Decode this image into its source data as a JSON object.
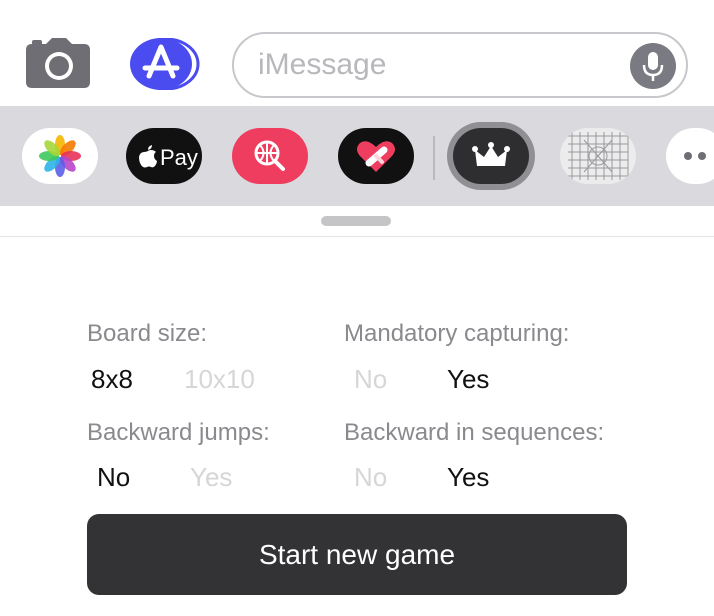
{
  "composer": {
    "placeholder": "iMessage",
    "camera_icon": "camera-icon",
    "appstore_icon": "app-store-icon",
    "mic_icon": "microphone-icon"
  },
  "app_drawer": {
    "items": [
      {
        "name": "photos",
        "icon": "photos-icon"
      },
      {
        "name": "apple-pay",
        "icon": "apple-icon",
        "label": "Pay"
      },
      {
        "name": "image-search",
        "icon": "globe-search-icon"
      },
      {
        "name": "digital-touch",
        "icon": "heart-icon"
      },
      {
        "name": "checkers",
        "icon": "crown-icon",
        "selected": true
      },
      {
        "name": "grid-app",
        "icon": "grid-icon"
      },
      {
        "name": "more",
        "icon": "more-icon"
      }
    ]
  },
  "settings": {
    "board_size": {
      "label": "Board size:",
      "options": [
        "8x8",
        "10x10"
      ],
      "selected": "8x8"
    },
    "mandatory_capturing": {
      "label": "Mandatory capturing:",
      "options": [
        "No",
        "Yes"
      ],
      "selected": "Yes"
    },
    "backward_jumps": {
      "label": "Backward jumps:",
      "options": [
        "No",
        "Yes"
      ],
      "selected": "No"
    },
    "backward_in_sequences": {
      "label": "Backward in sequences:",
      "options": [
        "No",
        "Yes"
      ],
      "selected": "Yes"
    }
  },
  "start_button": {
    "label": "Start new game"
  },
  "colors": {
    "appstore_blue": "#4a4cf0",
    "search_red": "#ef3d5f",
    "button_dark": "#333335",
    "label_gray": "#8a8a8e",
    "option_off": "#d6d6d8"
  }
}
